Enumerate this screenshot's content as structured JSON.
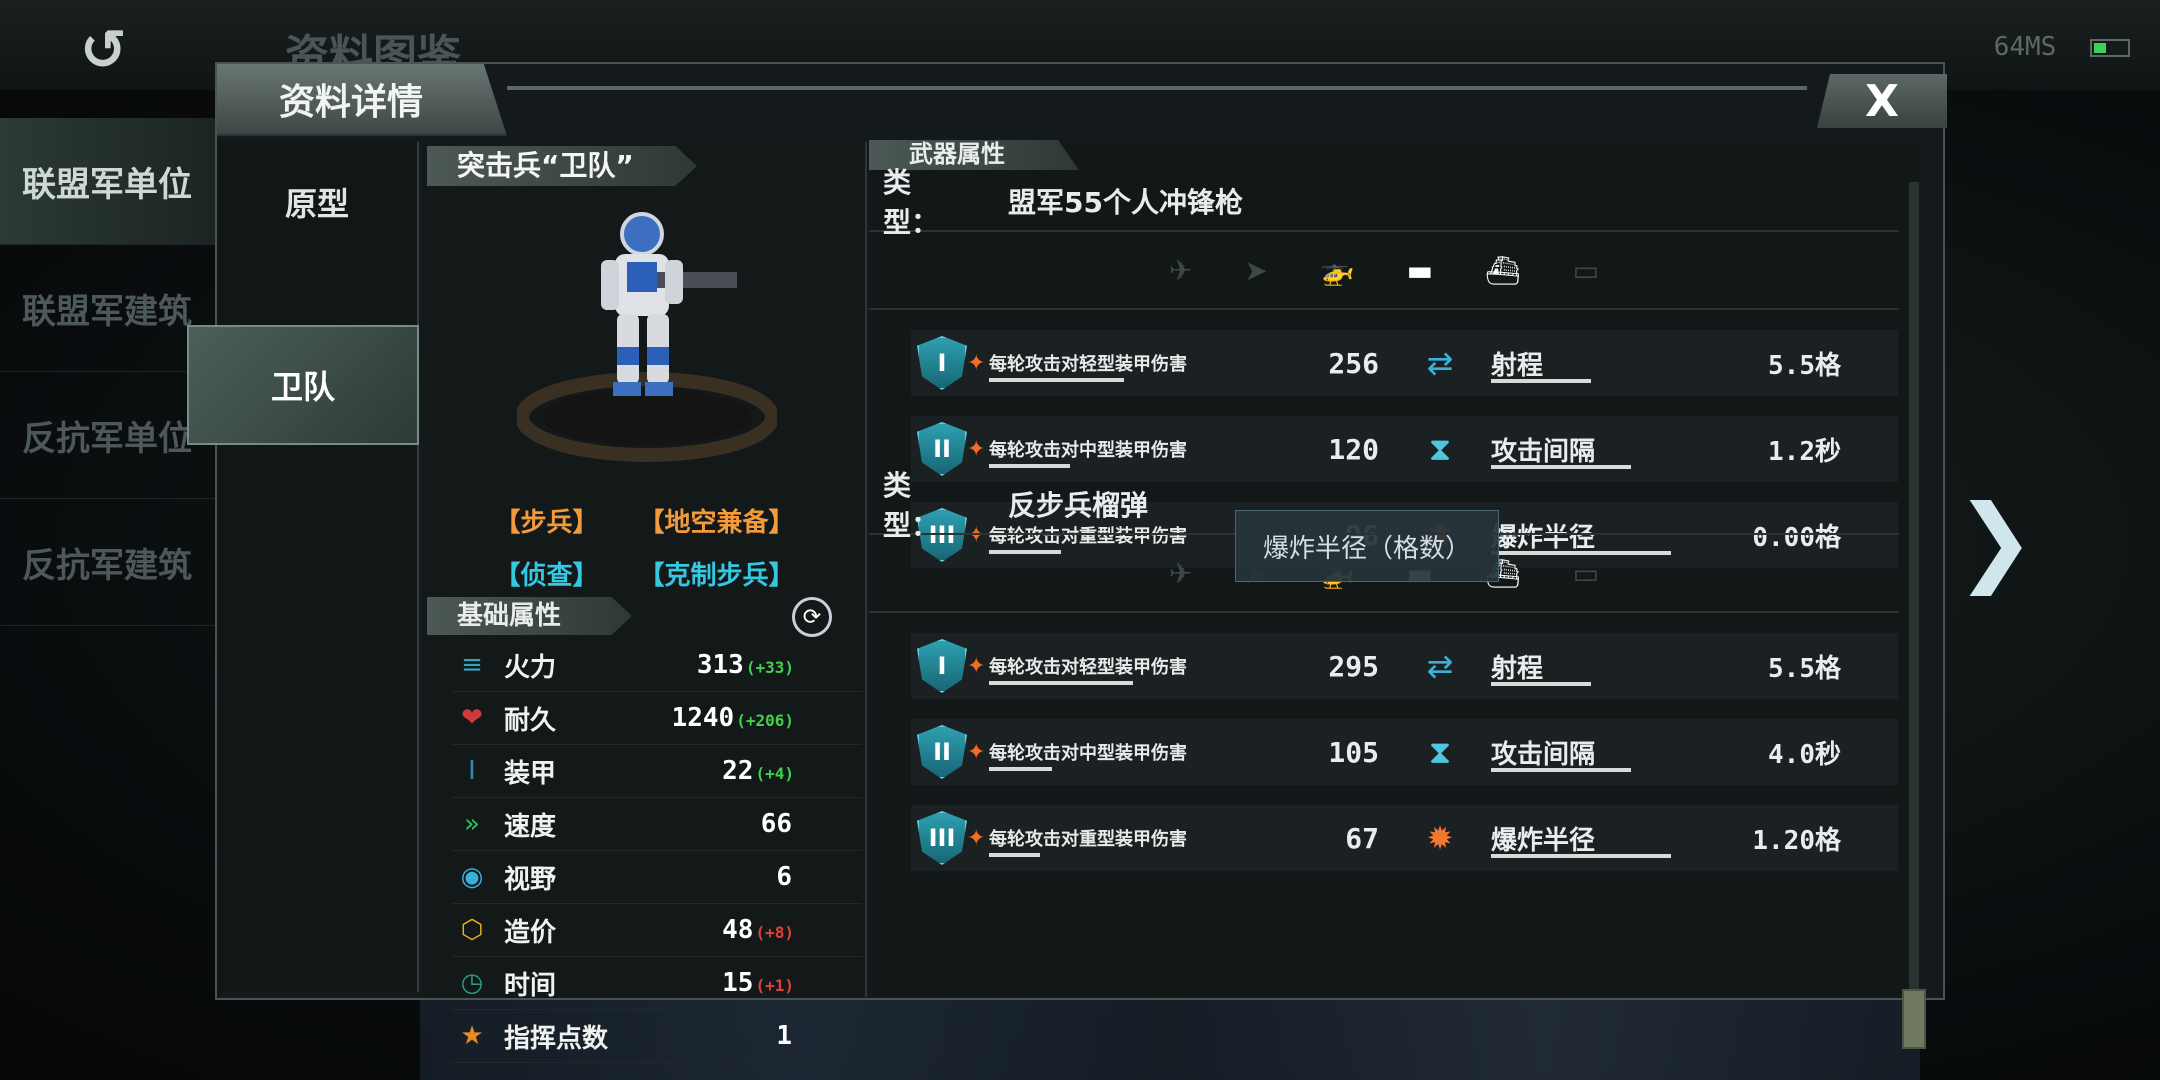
{
  "background": {
    "back_icon": "back-arrow-icon",
    "title": "资料图鉴",
    "status_ping": "64MS",
    "sidebar": [
      {
        "label": "联盟军单位"
      },
      {
        "label": "联盟军建筑"
      },
      {
        "label": "反抗军单位"
      },
      {
        "label": "反抗军建筑"
      }
    ]
  },
  "dialog": {
    "title": "资料详情",
    "close_label": "X",
    "tabs": [
      {
        "label": "原型"
      },
      {
        "label": "卫队"
      }
    ]
  },
  "unit": {
    "name": "突击兵“卫队”",
    "tags": [
      "【步兵】",
      "【地空兼备】",
      "【侦查】",
      "【克制步兵】"
    ],
    "base_header": "基础属性",
    "stats": [
      {
        "label": "火力",
        "value": "313",
        "bonus": "(+33)",
        "icon": "firepower-icon",
        "color": "#35a4c0"
      },
      {
        "label": "耐久",
        "value": "1240",
        "bonus": "(+206)",
        "icon": "heart-icon",
        "color": "#d03a3a"
      },
      {
        "label": "装甲",
        "value": "22",
        "bonus": "(+4)",
        "icon": "armor-shield-icon",
        "color": "#2e8ba8"
      },
      {
        "label": "速度",
        "value": "66",
        "bonus": "",
        "icon": "speed-chevron-icon",
        "color": "#2fbf5a"
      },
      {
        "label": "视野",
        "value": "6",
        "bonus": "",
        "icon": "eye-icon",
        "color": "#3ab0d8"
      },
      {
        "label": "造价",
        "value": "48",
        "bonus": "(+8)",
        "icon": "cost-cube-icon",
        "color": "#e8b020"
      },
      {
        "label": "时间",
        "value": "15",
        "bonus": "(+1)",
        "icon": "clock-icon",
        "color": "#2aa080"
      },
      {
        "label": "指挥点数",
        "value": "1",
        "bonus": "",
        "icon": "star-icon",
        "color": "#e88a20"
      }
    ]
  },
  "weapons": {
    "header": "武器属性",
    "type_label": "类　　型：",
    "list": [
      {
        "type": "盟军55个人冲锋枪",
        "targets": [
          false,
          false,
          true,
          true,
          true,
          false
        ],
        "rows": [
          {
            "armor": "I",
            "label": "每轮攻击对轻型装甲伤害",
            "value": "256",
            "attr_icon": "range-icon",
            "attr_label": "射程",
            "attr_value": "5.5格",
            "bar": 0.45
          },
          {
            "armor": "II",
            "label": "每轮攻击对中型装甲伤害",
            "value": "120",
            "attr_icon": "hourglass-icon",
            "attr_label": "攻击间隔",
            "attr_value": "1.2秒",
            "bar": 0.27
          },
          {
            "armor": "III",
            "label": "每轮攻击对重型装甲伤害",
            "value": "96",
            "attr_icon": "blast-radius-icon",
            "attr_label": "爆炸半径",
            "attr_value": "0.00格",
            "bar": 0.24
          }
        ]
      },
      {
        "type": "反步兵榴弹",
        "targets": [
          false,
          false,
          false,
          true,
          true,
          false
        ],
        "rows": [
          {
            "armor": "I",
            "label": "每轮攻击对轻型装甲伤害",
            "value": "295",
            "attr_icon": "range-icon",
            "attr_label": "射程",
            "attr_value": "5.5格",
            "bar": 0.48
          },
          {
            "armor": "II",
            "label": "每轮攻击对中型装甲伤害",
            "value": "105",
            "attr_icon": "hourglass-icon",
            "attr_label": "攻击间隔",
            "attr_value": "4.0秒",
            "bar": 0.21
          },
          {
            "armor": "III",
            "label": "每轮攻击对重型装甲伤害",
            "value": "67",
            "attr_icon": "blast-radius-icon",
            "attr_label": "爆炸半径",
            "attr_value": "1.20格",
            "bar": 0.17
          }
        ]
      }
    ],
    "target_icons": [
      "jet-icon",
      "bomber-icon",
      "helicopter-icon",
      "tank-icon",
      "ship-icon",
      "submarine-icon"
    ]
  },
  "tooltip": "爆炸半径（格数）"
}
